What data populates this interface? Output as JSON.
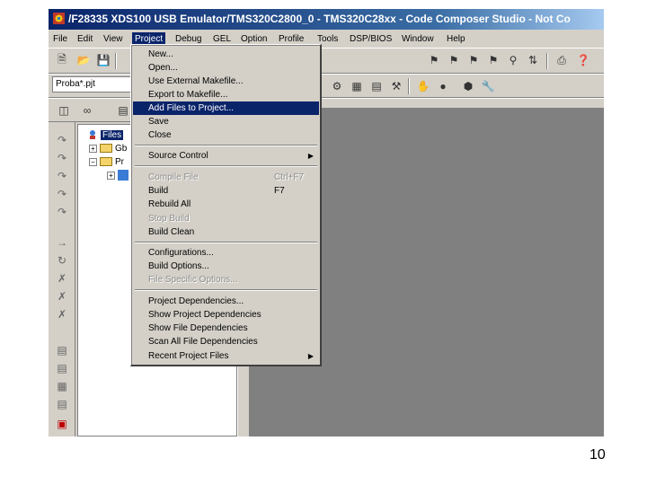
{
  "window": {
    "title": "/F28335 XDS100 USB Emulator/TMS320C2800_0 - TMS320C28xx - Code Composer Studio - Not Co"
  },
  "menubar": {
    "items": [
      "File",
      "Edit",
      "View",
      "Project",
      "Debug",
      "GEL",
      "Option",
      "Profile",
      "Tools",
      "DSP/BIOS",
      "Window",
      "Help"
    ],
    "active": "Project"
  },
  "toolbar": {
    "project_combo_value": "Proba*.pjt"
  },
  "tree": {
    "root_label": "Files",
    "nodes": [
      "Gb",
      "Pr"
    ]
  },
  "project_menu": {
    "items": [
      {
        "label": "New...",
        "enabled": true
      },
      {
        "label": "Open...",
        "enabled": true
      },
      {
        "label": "Use External Makefile...",
        "enabled": true
      },
      {
        "label": "Export to Makefile...",
        "enabled": true
      },
      {
        "label": "Add Files to Project...",
        "enabled": true,
        "highlighted": true
      },
      {
        "label": "Save",
        "enabled": true
      },
      {
        "label": "Close",
        "enabled": true
      },
      {
        "label": "Source Control",
        "enabled": true,
        "submenu": true
      },
      {
        "label": "Compile File",
        "enabled": false,
        "shortcut": "Ctrl+F7"
      },
      {
        "label": "Build",
        "enabled": true,
        "shortcut": "F7"
      },
      {
        "label": "Rebuild All",
        "enabled": true
      },
      {
        "label": "Stop Build",
        "enabled": false
      },
      {
        "label": "Build Clean",
        "enabled": true
      },
      {
        "label": "Configurations...",
        "enabled": true
      },
      {
        "label": "Build Options...",
        "enabled": true
      },
      {
        "label": "File Specific Options...",
        "enabled": false
      },
      {
        "label": "Project Dependencies...",
        "enabled": true
      },
      {
        "label": "Show Project Dependencies",
        "enabled": true
      },
      {
        "label": "Show File Dependencies",
        "enabled": true
      },
      {
        "label": "Scan All File Dependencies",
        "enabled": true
      },
      {
        "label": "Recent Project Files",
        "enabled": true,
        "submenu": true
      }
    ]
  },
  "slide": {
    "page_number": "10"
  }
}
